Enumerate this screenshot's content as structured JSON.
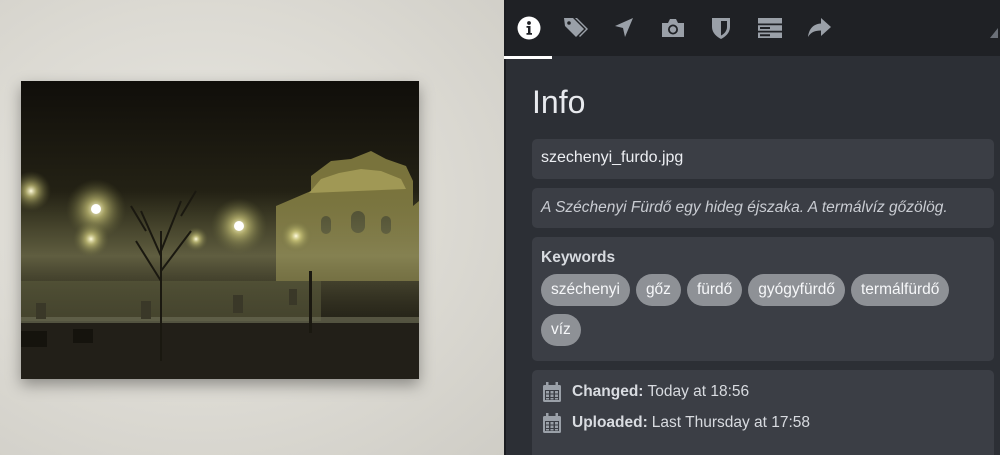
{
  "tabs": [
    {
      "icon": "info-circle-icon",
      "active": true
    },
    {
      "icon": "tags-icon",
      "active": false
    },
    {
      "icon": "location-arrow-icon",
      "active": false
    },
    {
      "icon": "camera-icon",
      "active": false
    },
    {
      "icon": "shield-icon",
      "active": false
    },
    {
      "icon": "server-icon",
      "active": false
    },
    {
      "icon": "share-arrow-icon",
      "active": false
    }
  ],
  "panel": {
    "title": "Info",
    "filename": "szechenyi_furdo.jpg",
    "caption": "A Széchenyi Fürdő egy hideg éjszaka. A termálvíz gőzölög.",
    "keywords_label": "Keywords",
    "keywords": [
      "széchenyi",
      "gőz",
      "fürdő",
      "gyógyfürdő",
      "termálfürdő",
      "víz"
    ],
    "changed_label": "Changed:",
    "changed_value": "Today at 18:56",
    "uploaded_label": "Uploaded:",
    "uploaded_value": "Last Thursday at 17:58"
  },
  "colors": {
    "panel_bg": "#2c2f35",
    "tabbar_bg": "#1f2125",
    "field_bg": "#3b3e45",
    "chip_bg": "#8e9196",
    "active_indicator": "#ffffff"
  }
}
